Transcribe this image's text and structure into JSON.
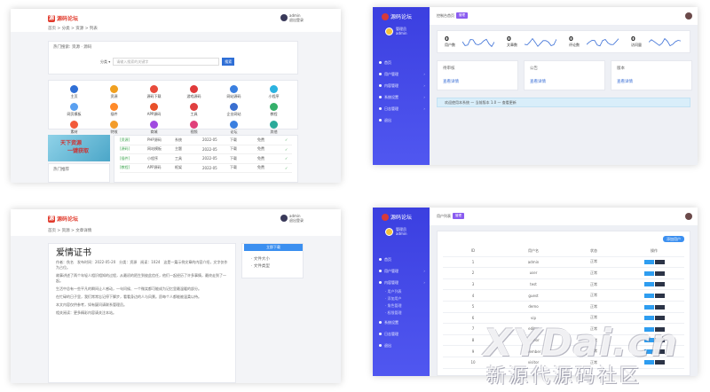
{
  "shot1": {
    "logo": "源码论坛",
    "user": [
      "admin",
      "退出登录"
    ],
    "crumb": "首页 > 分类 > 资源 > 列表",
    "search": {
      "label": "分类 ▾",
      "placeholder": "请输入搜索的关键字",
      "btn": "搜索"
    },
    "hint": "热门搜索: 资源 · 源码",
    "icons": [
      {
        "label": "主页",
        "color": "#2f6fd6"
      },
      {
        "label": "资源",
        "color": "#f0a020"
      },
      {
        "label": "源码下载",
        "color": "#e84b3c"
      },
      {
        "label": "游戏源码",
        "color": "#e03a3a"
      },
      {
        "label": "网站源码",
        "color": "#3a7fe0"
      },
      {
        "label": "小程序",
        "color": "#2bb2e0"
      },
      {
        "label": "网页模板",
        "color": "#5aa0f0"
      },
      {
        "label": "插件",
        "color": "#ff8a2a"
      },
      {
        "label": "APP源码",
        "color": "#e8502a"
      },
      {
        "label": "工具",
        "color": "#e04040"
      },
      {
        "label": "企业网站",
        "color": "#3a6fd0"
      },
      {
        "label": "教程",
        "color": "#35b06a"
      },
      {
        "label": "素材",
        "color": "#f25a3a"
      },
      {
        "label": "特效",
        "color": "#f39c2a"
      },
      {
        "label": "商城",
        "color": "#a04ae0"
      },
      {
        "label": "视频",
        "color": "#e0407a"
      },
      {
        "label": "论坛",
        "color": "#3a7fe0"
      },
      {
        "label": "其他",
        "color": "#2aaa9a"
      }
    ],
    "banner": [
      "天下资源",
      "一键获取"
    ],
    "sidebar_heading": "热门推荐",
    "rows": [
      [
        "[资源]",
        "PHP源码",
        "系统",
        "2022-05",
        "下载",
        "免费",
        "✓"
      ],
      [
        "[源码]",
        "网站模板",
        "主题",
        "2022-05",
        "下载",
        "免费",
        "✓"
      ],
      [
        "[插件]",
        "小程序",
        "工具",
        "2022-05",
        "下载",
        "免费",
        "✓"
      ],
      [
        "[教程]",
        "APP源码",
        "框架",
        "2022-05",
        "下载",
        "免费",
        "✓"
      ]
    ]
  },
  "shot2": {
    "brand": "源码论坛",
    "profile": [
      "管理员",
      "admin"
    ],
    "header": "控制台首页",
    "header_tag": "管理",
    "menu": [
      "首页",
      "用户管理",
      "内容管理",
      "系统设置",
      "日志管理",
      "退出"
    ],
    "stats": [
      {
        "value": "0",
        "label": "用户数"
      },
      {
        "value": "0",
        "label": "文章数"
      },
      {
        "value": "0",
        "label": "评论数"
      },
      {
        "value": "0",
        "label": "访问量"
      }
    ],
    "boxes": [
      {
        "title": "待审核",
        "link": "查看详情"
      },
      {
        "title": "公告",
        "link": "查看详情"
      },
      {
        "title": "版本",
        "link": "查看详情"
      }
    ],
    "notice": "欢迎使用本系统 — 当前版本 1.0 — 查看更新"
  },
  "shot3": {
    "logo": "源码论坛",
    "user": [
      "admin",
      "退出登录"
    ],
    "crumb": "首页 > 资源 > 文章详情",
    "title": "爱情证书",
    "paras": [
      "作者：佚名　发布时间：2022-05-20　分类：资源　阅读：1024　这是一篇示例文章的内容介绍，文字仅作为占位。",
      "故事讲述了两个年轻人相识相知的过程，从最初的陌生到彼此信任，他们一起经历了许多事情，最终走到了一起。",
      "生活中总有一些平凡的瞬间让人感动，一句问候、一个微笑都可能成为记忆里最温暖的部分。",
      "在忙碌的日子里，我们常常忘记停下脚步，看看身边的人与风景。愿每个人都能被温柔以待。",
      "本文内容仅供参考，如有疑问请联系管理员。",
      "相关阅读：更多精彩内容请关注本站。"
    ],
    "side_btn": "立即下载",
    "side_items": [
      "· 文件大小",
      "· 文件类型"
    ]
  },
  "shot4": {
    "brand": "源码论坛",
    "profile": [
      "管理员",
      "admin"
    ],
    "header": "用户列表",
    "header_tag": "管理",
    "menu": [
      "首页",
      "用户管理",
      "内容管理",
      "· 用户列表",
      "· 添加用户",
      "· 角色管理",
      "· 权限管理",
      "系统设置",
      "日志管理",
      "退出"
    ],
    "add_btn": "添加用户",
    "cols": [
      "ID",
      "用户名",
      "状态",
      "操作"
    ],
    "rows": [
      [
        "1",
        "admin",
        "正常"
      ],
      [
        "2",
        "user",
        "正常"
      ],
      [
        "3",
        "test",
        "正常"
      ],
      [
        "4",
        "guest",
        "正常"
      ],
      [
        "5",
        "demo",
        "正常"
      ],
      [
        "6",
        "vip",
        "正常"
      ],
      [
        "7",
        "editor",
        "正常"
      ],
      [
        "8",
        "author",
        "正常"
      ],
      [
        "9",
        "member",
        "正常"
      ],
      [
        "10",
        "visitor",
        "正常"
      ]
    ],
    "edit": "编辑",
    "del": "删除"
  },
  "watermark": {
    "top": "XYDai.cn",
    "bottom": "新源代源码社区"
  }
}
